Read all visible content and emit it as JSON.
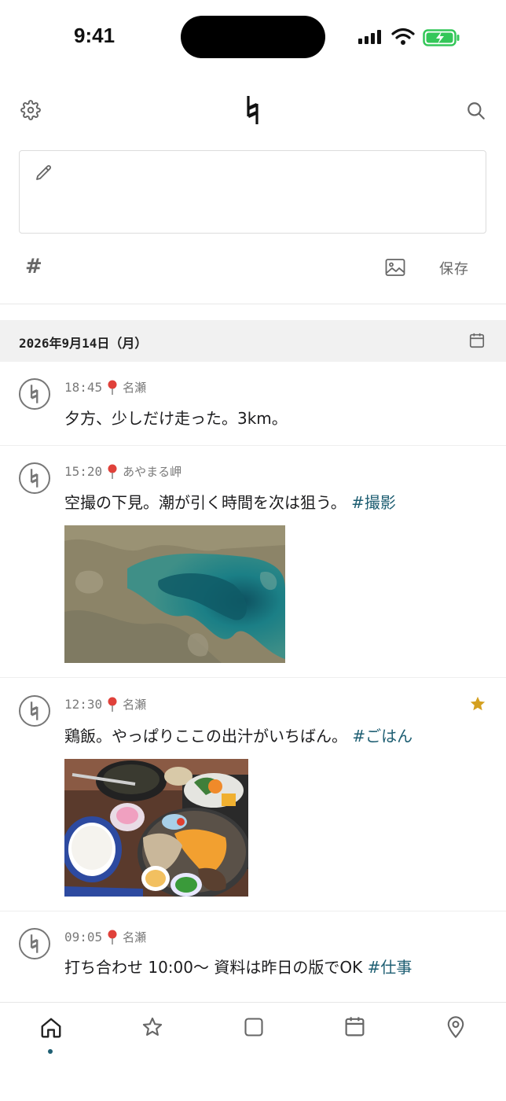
{
  "status_bar": {
    "time": "9:41"
  },
  "header": {
    "settings_icon": "gear-icon",
    "logo_icon": "natural-sign-logo",
    "search_icon": "search-icon"
  },
  "composer": {
    "placeholder_icon": "pencil-icon",
    "hashtag_label": "#",
    "image_icon": "image-icon",
    "save_label": "保存"
  },
  "date_header": {
    "label": "2026年9月14日（月）",
    "icon": "calendar-icon"
  },
  "entries": [
    {
      "time": "18:45",
      "location": "名瀬",
      "text": "夕方、少しだけ走った。3km。",
      "tag": "",
      "starred": false,
      "has_photo": false
    },
    {
      "time": "15:20",
      "location": "あやまる岬",
      "text": "空撮の下見。潮が引く時間を次は狙う。",
      "tag": "#撮影",
      "starred": false,
      "has_photo": true,
      "photo": "aerial-reef-photo"
    },
    {
      "time": "12:30",
      "location": "名瀬",
      "text": "鶏飯。やっぱりここの出汁がいちばん。",
      "tag": "#ごはん",
      "starred": true,
      "has_photo": true,
      "photo": "keihan-meal-photo"
    },
    {
      "time": "09:05",
      "location": "名瀬",
      "text": "打ち合わせ 10:00〜 資料は昨日の版でOK",
      "tag": "#仕事",
      "starred": false,
      "has_photo": false
    }
  ],
  "bottom_nav": {
    "items": [
      "home-icon",
      "star-icon",
      "square-icon",
      "calendar-icon",
      "map-pin-icon"
    ],
    "active": "home-icon"
  },
  "colors": {
    "tag": "#1f5f73",
    "star": "#d4a020",
    "pin": "#e0413a",
    "battery": "#34c759"
  }
}
